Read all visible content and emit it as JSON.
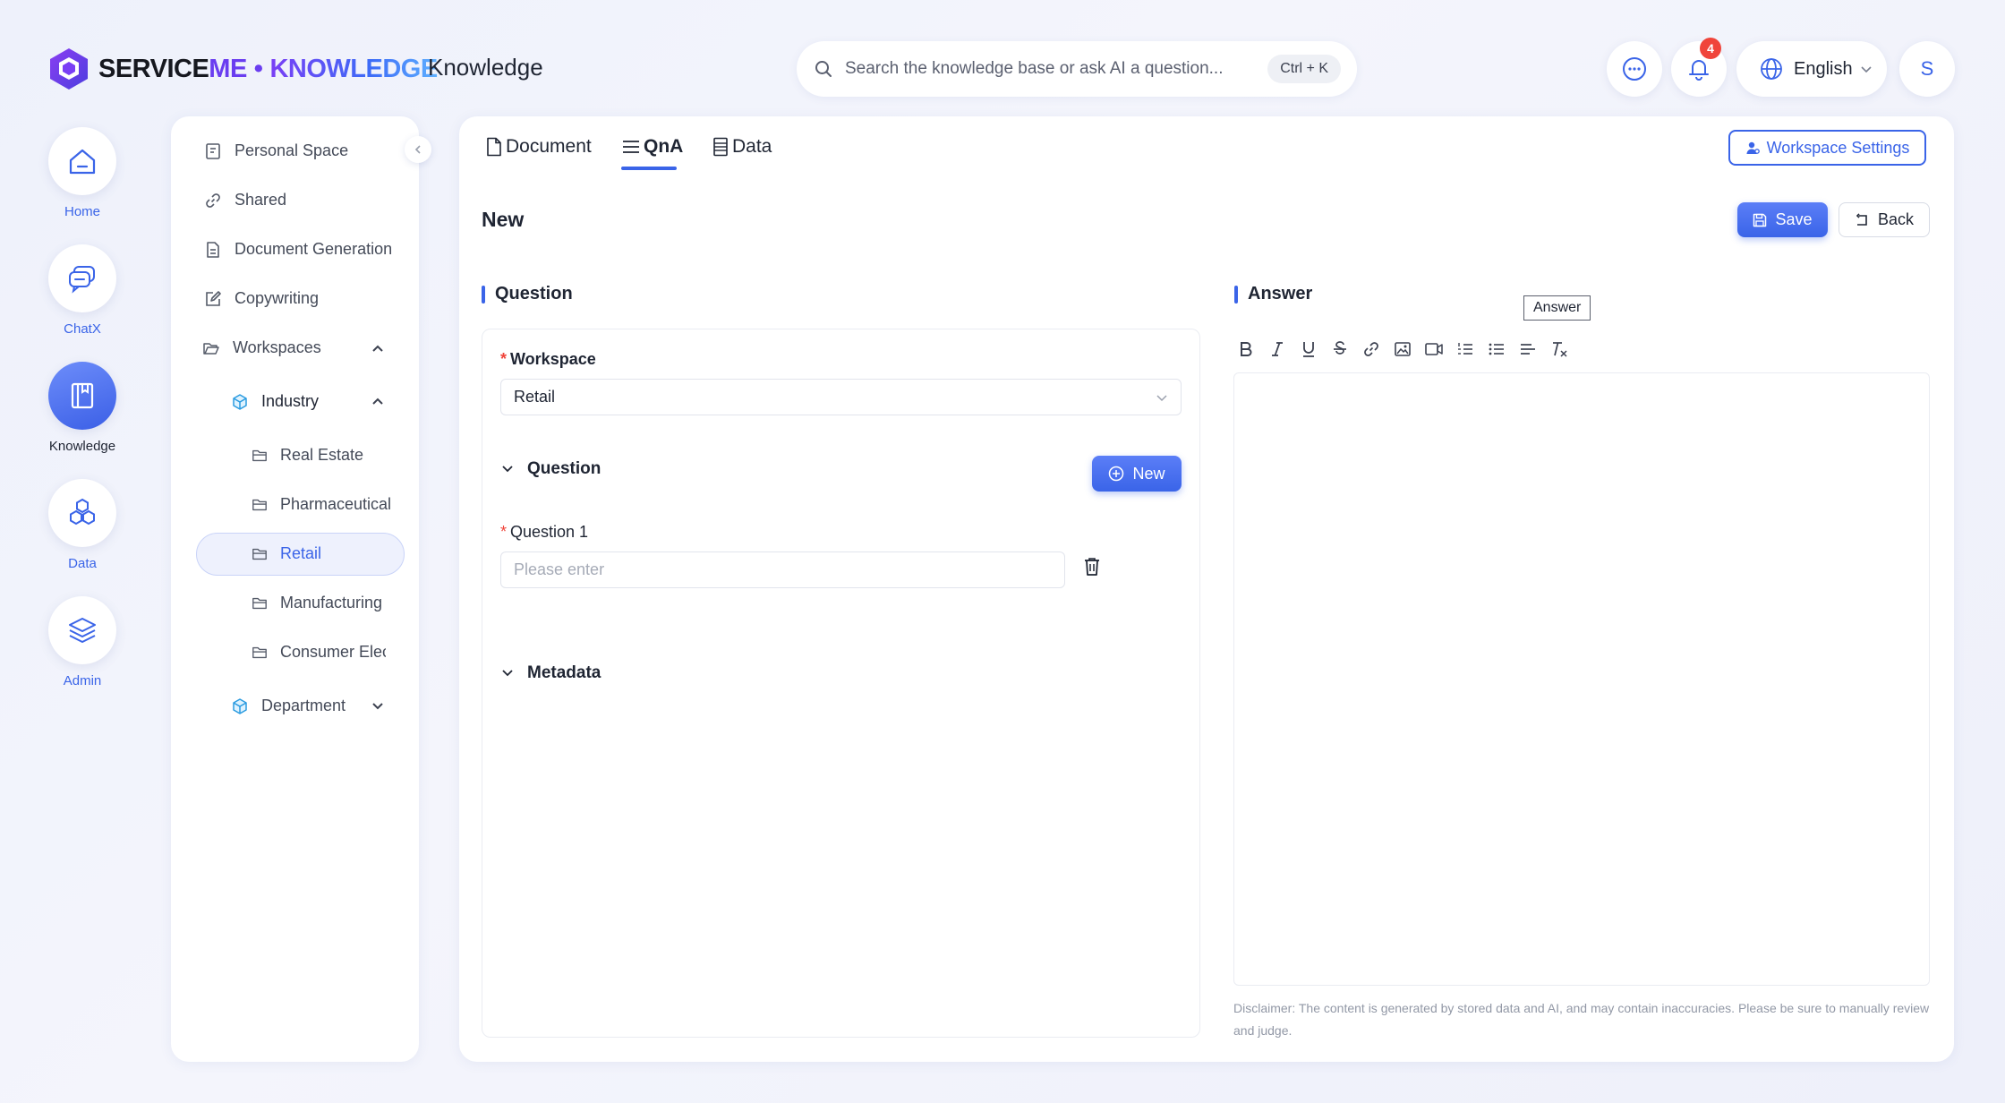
{
  "header": {
    "logo_service": "SERVICE",
    "logo_me": "ME",
    "logo_dot": "•",
    "logo_knowledge": "KNOWLEDGE",
    "app_title": "Knowledge",
    "search_placeholder": "Search the knowledge base or ask AI a question...",
    "search_shortcut": "Ctrl + K",
    "notification_count": "4",
    "language": "English",
    "avatar_initial": "S"
  },
  "rail": {
    "home": "Home",
    "chatx": "ChatX",
    "knowledge": "Knowledge",
    "data": "Data",
    "admin": "Admin"
  },
  "sidebar": {
    "personal_space": "Personal Space",
    "shared": "Shared",
    "document_generation": "Document Generation",
    "copywriting": "Copywriting",
    "workspaces": "Workspaces",
    "industry": "Industry",
    "real_estate": "Real Estate",
    "pharmaceutical": "Pharmaceutical",
    "retail": "Retail",
    "manufacturing": "Manufacturing",
    "consumer_elect": "Consumer Elect",
    "department": "Department"
  },
  "tabs": {
    "document": "Document",
    "qna": "QnA",
    "data": "Data"
  },
  "toolbar": {
    "workspace_settings": "Workspace Settings",
    "save": "Save",
    "back": "Back"
  },
  "form": {
    "heading": "New",
    "question_section": "Question",
    "answer_section": "Answer",
    "workspace_label": "Workspace",
    "workspace_value": "Retail",
    "question_group": "Question",
    "new_button": "New",
    "question1_label": "Question 1",
    "question1_placeholder": "Please enter",
    "metadata_group": "Metadata"
  },
  "editor": {
    "tooltip": "Answer",
    "disclaimer": "Disclaimer: The content is generated by stored data and AI, and may contain inaccuracies. Please be sure to manually review and judge."
  },
  "colors": {
    "accent": "#3a64e8",
    "required": "#f0443a",
    "badge": "#f0443a"
  }
}
